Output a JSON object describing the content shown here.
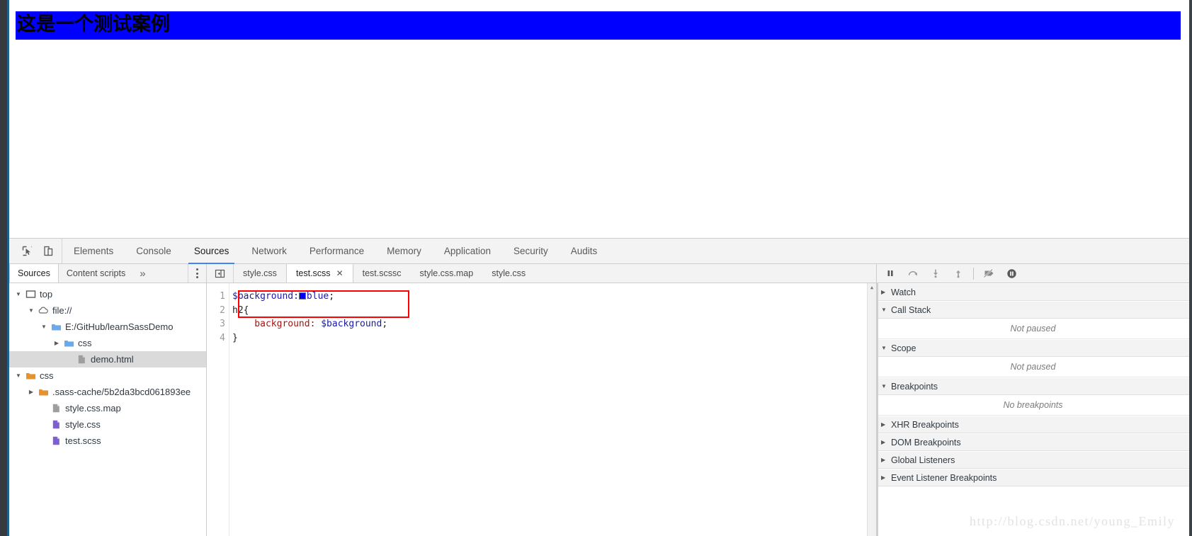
{
  "page": {
    "heading_text": "这是一个测试案例",
    "heading_background": "#0000ff"
  },
  "devtools": {
    "toolbar_icons": [
      {
        "name": "inspect-element-icon"
      },
      {
        "name": "device-toolbar-icon"
      }
    ],
    "tabs": [
      {
        "label": "Elements",
        "active": false
      },
      {
        "label": "Console",
        "active": false
      },
      {
        "label": "Sources",
        "active": true
      },
      {
        "label": "Network",
        "active": false
      },
      {
        "label": "Performance",
        "active": false
      },
      {
        "label": "Memory",
        "active": false
      },
      {
        "label": "Application",
        "active": false
      },
      {
        "label": "Security",
        "active": false
      },
      {
        "label": "Audits",
        "active": false
      }
    ],
    "active_tab_underline_color": "#4285f4"
  },
  "navigator": {
    "tabs": [
      {
        "label": "Sources",
        "active": true
      },
      {
        "label": "Content scripts",
        "active": false
      }
    ],
    "overflow_label": "»",
    "menu_icon": "more-vertical-icon",
    "tree": [
      {
        "label": "top",
        "icon": "frame-icon",
        "twisty": "▼",
        "indent": 0,
        "selected": false
      },
      {
        "label": "file://",
        "icon": "cloud-icon",
        "twisty": "▼",
        "indent": 1,
        "selected": false
      },
      {
        "label": "E:/GitHub/learnSassDemo",
        "icon": "folder-blue-icon",
        "twisty": "▼",
        "indent": 2,
        "selected": false
      },
      {
        "label": "css",
        "icon": "folder-blue-icon",
        "twisty": "▶",
        "indent": 3,
        "selected": false
      },
      {
        "label": "demo.html",
        "icon": "file-gray-icon",
        "twisty": "",
        "indent": 4,
        "selected": true
      },
      {
        "label": "css",
        "icon": "folder-orange-icon",
        "twisty": "▼",
        "indent": 0,
        "selected": false
      },
      {
        "label": ".sass-cache/5b2da3bcd061893ee",
        "icon": "folder-orange-icon",
        "twisty": "▶",
        "indent": 1,
        "selected": false
      },
      {
        "label": "style.css.map",
        "icon": "file-gray-icon",
        "twisty": "",
        "indent": 2,
        "selected": false
      },
      {
        "label": "style.css",
        "icon": "file-purple-icon",
        "twisty": "",
        "indent": 2,
        "selected": false
      },
      {
        "label": "test.scss",
        "icon": "file-purple-icon",
        "twisty": "",
        "indent": 2,
        "selected": false
      }
    ]
  },
  "editor": {
    "side_button_icon": "show-navigator-icon",
    "tabs": [
      {
        "label": "style.css",
        "active": false,
        "closable": false
      },
      {
        "label": "test.scss",
        "active": true,
        "closable": true,
        "close_label": "✕"
      },
      {
        "label": "test.scssc",
        "active": false,
        "closable": false
      },
      {
        "label": "style.css.map",
        "active": false,
        "closable": false
      },
      {
        "label": "style.css",
        "active": false,
        "closable": false
      }
    ],
    "line_numbers": [
      "1",
      "2",
      "3",
      "4"
    ],
    "code": [
      {
        "n": "1",
        "tokens": [
          {
            "t": "$background:",
            "c": "var"
          },
          {
            "t": "swatch",
            "c": "swatch"
          },
          {
            "t": "blue",
            "c": "val"
          },
          {
            "t": ";",
            "c": "plain"
          }
        ]
      },
      {
        "n": "2",
        "tokens": [
          {
            "t": "h2{",
            "c": "plain"
          }
        ]
      },
      {
        "n": "3",
        "tokens": [
          {
            "t": "    background:",
            "c": "prop"
          },
          {
            "t": " ",
            "c": "plain"
          },
          {
            "t": "$background",
            "c": "var"
          },
          {
            "t": ";",
            "c": "plain"
          }
        ]
      },
      {
        "n": "4",
        "tokens": [
          {
            "t": "}",
            "c": "plain"
          }
        ]
      }
    ],
    "swatch_color": "#0000ff",
    "annotation_color": "#ff0000"
  },
  "debugger": {
    "buttons": [
      {
        "name": "pause-resume-button",
        "icon": "pause-icon"
      },
      {
        "name": "step-over-button",
        "icon": "step-over-icon"
      },
      {
        "name": "step-into-button",
        "icon": "step-into-icon"
      },
      {
        "name": "step-out-button",
        "icon": "step-out-icon"
      },
      {
        "name": "deactivate-breakpoints-button",
        "icon": "deactivate-breakpoints-icon"
      },
      {
        "name": "pause-on-exceptions-button",
        "icon": "pause-on-exceptions-icon"
      }
    ],
    "sections": [
      {
        "label": "Watch",
        "expanded": false,
        "caret": "▶",
        "empty_text": null
      },
      {
        "label": "Call Stack",
        "expanded": true,
        "caret": "▼",
        "empty_text": "Not paused"
      },
      {
        "label": "Scope",
        "expanded": true,
        "caret": "▼",
        "empty_text": "Not paused"
      },
      {
        "label": "Breakpoints",
        "expanded": true,
        "caret": "▼",
        "empty_text": "No breakpoints"
      },
      {
        "label": "XHR Breakpoints",
        "expanded": false,
        "caret": "▶",
        "empty_text": null
      },
      {
        "label": "DOM Breakpoints",
        "expanded": false,
        "caret": "▶",
        "empty_text": null
      },
      {
        "label": "Global Listeners",
        "expanded": false,
        "caret": "▶",
        "empty_text": null
      },
      {
        "label": "Event Listener Breakpoints",
        "expanded": false,
        "caret": "▶",
        "empty_text": null
      }
    ]
  },
  "watermark": {
    "text": "http://blog.csdn.net/young_Emily"
  }
}
